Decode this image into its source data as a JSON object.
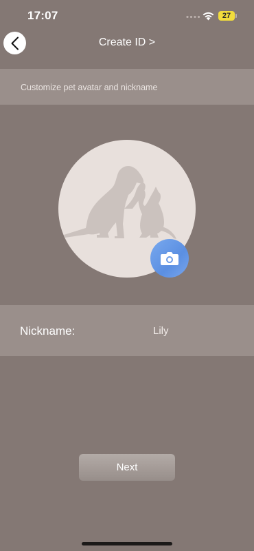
{
  "status_bar": {
    "time": "17:07",
    "battery_level": "27",
    "battery_color": "#f2dc3c"
  },
  "header": {
    "back_icon": "chevron-left-icon",
    "title": "Create ID >"
  },
  "subtitle": "Customize pet avatar and nickname",
  "avatar": {
    "image": "dog-and-cat-silhouette",
    "camera_icon": "camera-icon",
    "camera_color": "#5b8fe2"
  },
  "nickname": {
    "label": "Nickname:",
    "value": "Lily"
  },
  "actions": {
    "next_label": "Next"
  },
  "colors": {
    "background": "#847874",
    "band": "#9a8f8b",
    "avatar_circle": "#e8e0dc"
  }
}
